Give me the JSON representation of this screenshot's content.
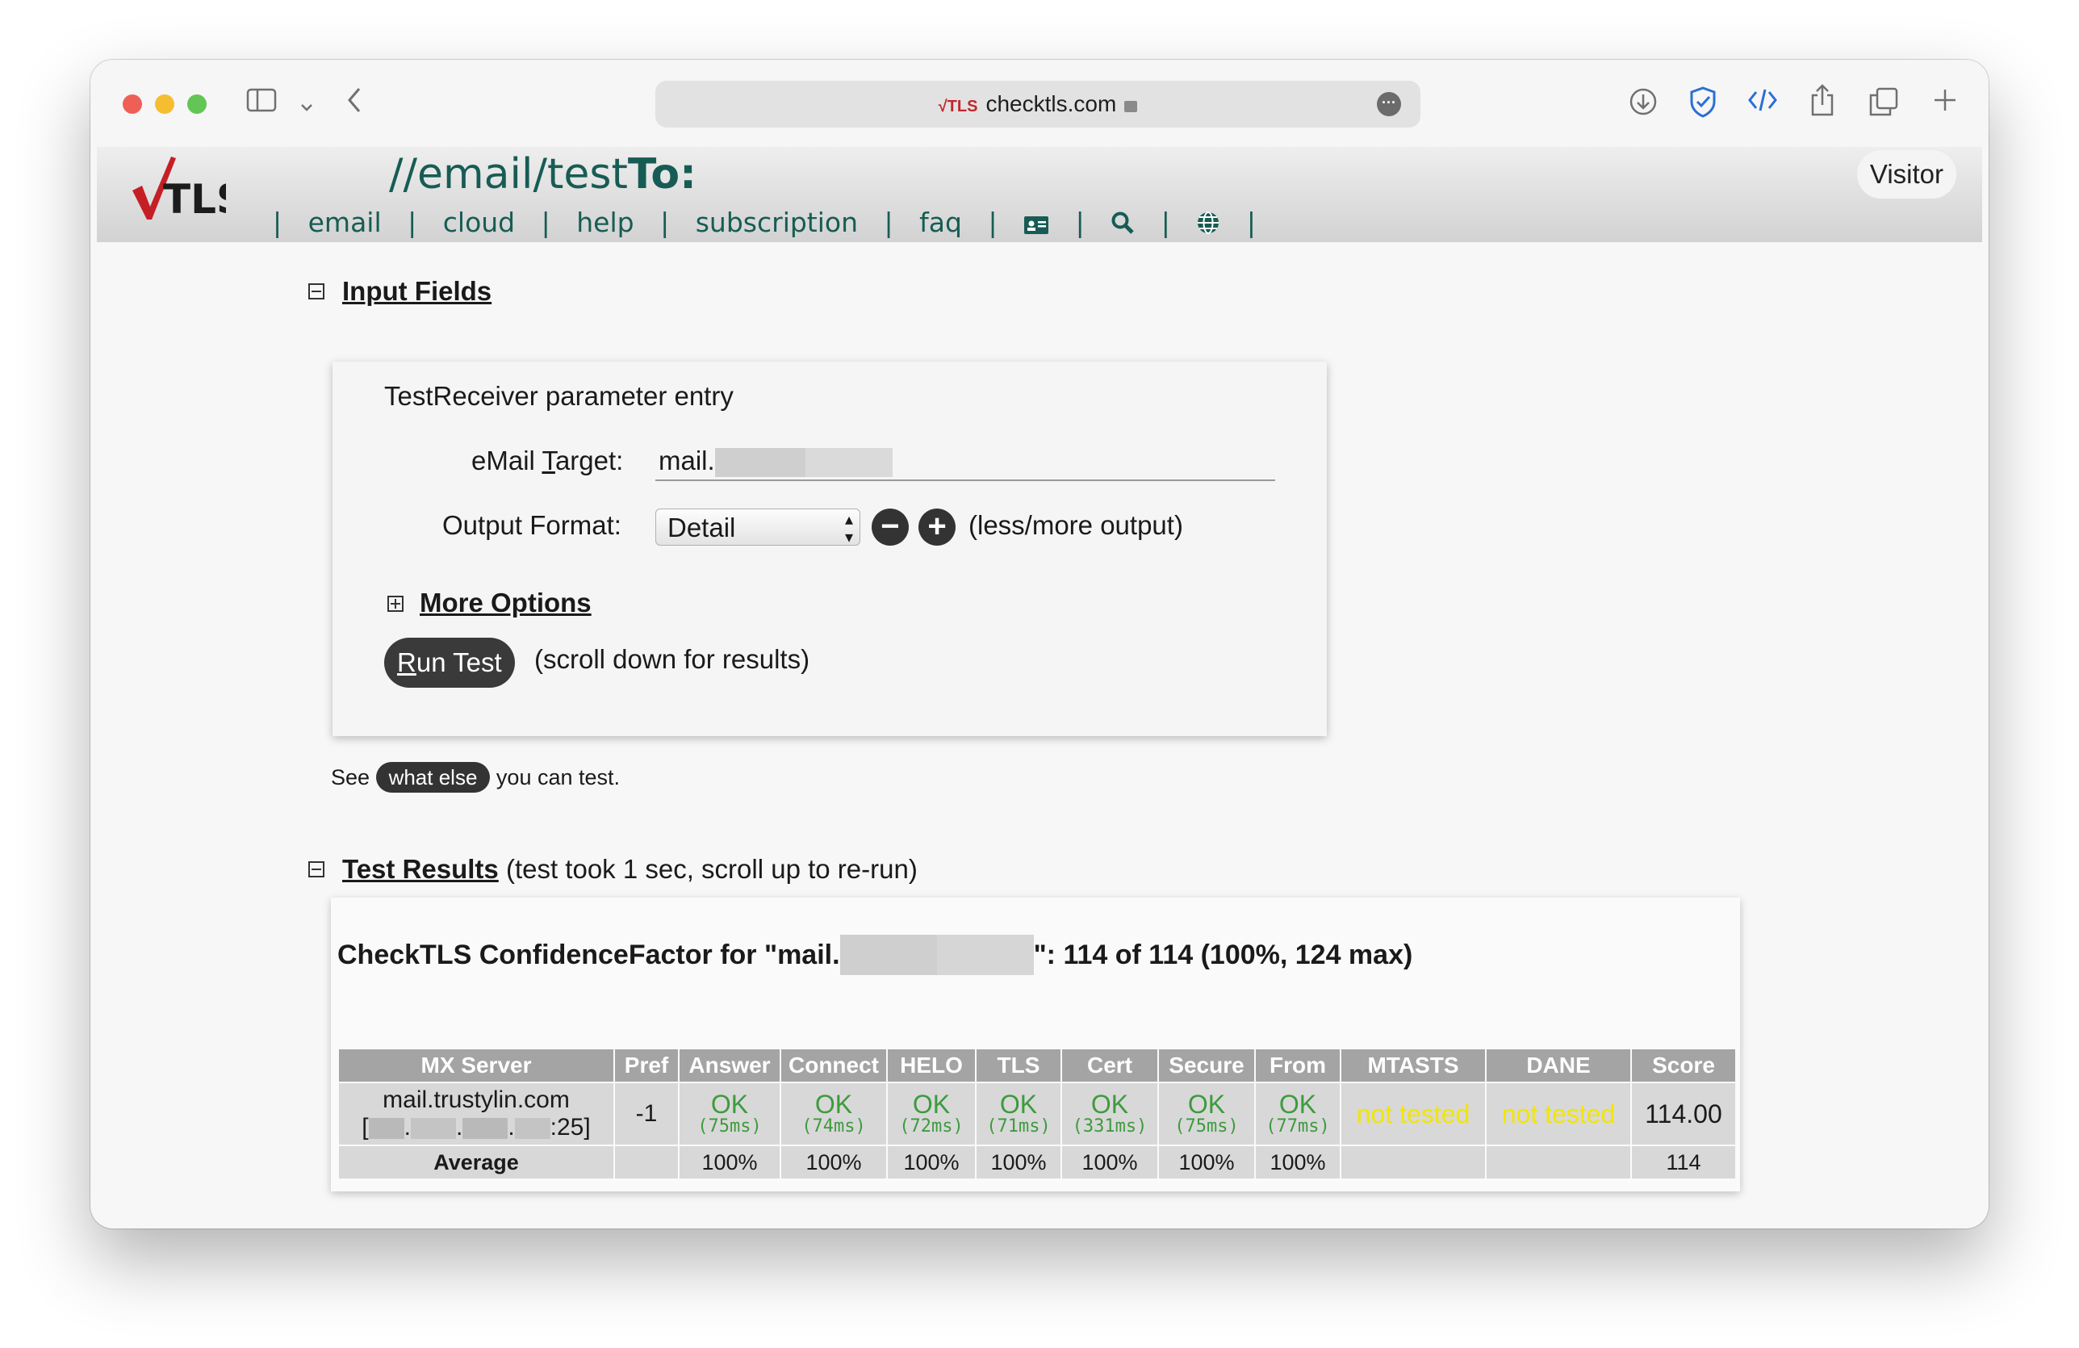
{
  "browser": {
    "url_display": "checktls.com",
    "url_logo": "√TLS",
    "colors": {
      "close": "#ee5f56",
      "minimize": "#f5bd2f",
      "zoom": "#62c554"
    },
    "toolbar_icons": [
      "sidebar-icon",
      "chevron-down-icon",
      "back-icon",
      "download-icon",
      "shield-icon",
      "code-icon",
      "share-icon",
      "tabs-icon",
      "plus-icon"
    ]
  },
  "site": {
    "logo_text": "TLS",
    "title_prefix": "//email/test",
    "title_suffix": "To:",
    "nav": [
      "email",
      "cloud",
      "help",
      "subscription",
      "faq"
    ],
    "visitor_label": "Visitor",
    "accent_color": "#175c54"
  },
  "input_section": {
    "title": "Input Fields",
    "panel_title": "TestReceiver parameter entry",
    "target_label_pre": "eMail ",
    "target_label_key": "T",
    "target_label_post": "arget:",
    "target_value": "mail.",
    "format_label": "Output Format:",
    "format_value": "Detail",
    "output_hint": "(less/more output)",
    "more_options": "More Options",
    "run_key": "R",
    "run_rest": "un Test",
    "run_hint": "(scroll down for results)",
    "see_pre": "See",
    "what_else": "what else",
    "see_post": "you can test."
  },
  "results_section": {
    "title": "Test Results",
    "subtitle": "(test took 1 sec, scroll up to re-run)",
    "cf_pre": "CheckTLS ConfidenceFactor for \"mail.",
    "cf_post": "\": 114 of 114 (100%, 124 max)",
    "columns": [
      "MX Server",
      "Pref",
      "Answer",
      "Connect",
      "HELO",
      "TLS",
      "Cert",
      "Secure",
      "From",
      "MTASTS",
      "DANE",
      "Score"
    ],
    "row": {
      "server": "mail.trustylin.com",
      "ip_open": "[",
      "ip_close": ":25]",
      "pref": "-1",
      "checks": [
        {
          "status": "OK",
          "time": "(75ms)"
        },
        {
          "status": "OK",
          "time": "(74ms)"
        },
        {
          "status": "OK",
          "time": "(72ms)"
        },
        {
          "status": "OK",
          "time": "(71ms)"
        },
        {
          "status": "OK",
          "time": "(331ms)"
        },
        {
          "status": "OK",
          "time": "(75ms)"
        },
        {
          "status": "OK",
          "time": "(77ms)"
        }
      ],
      "mtasts": "not tested",
      "dane": "not tested",
      "score": "114.00"
    },
    "average": {
      "label": "Average",
      "pref": "",
      "values": [
        "100%",
        "100%",
        "100%",
        "100%",
        "100%",
        "100%",
        "100%"
      ],
      "mtasts": "",
      "dane": "",
      "score": "114"
    }
  }
}
